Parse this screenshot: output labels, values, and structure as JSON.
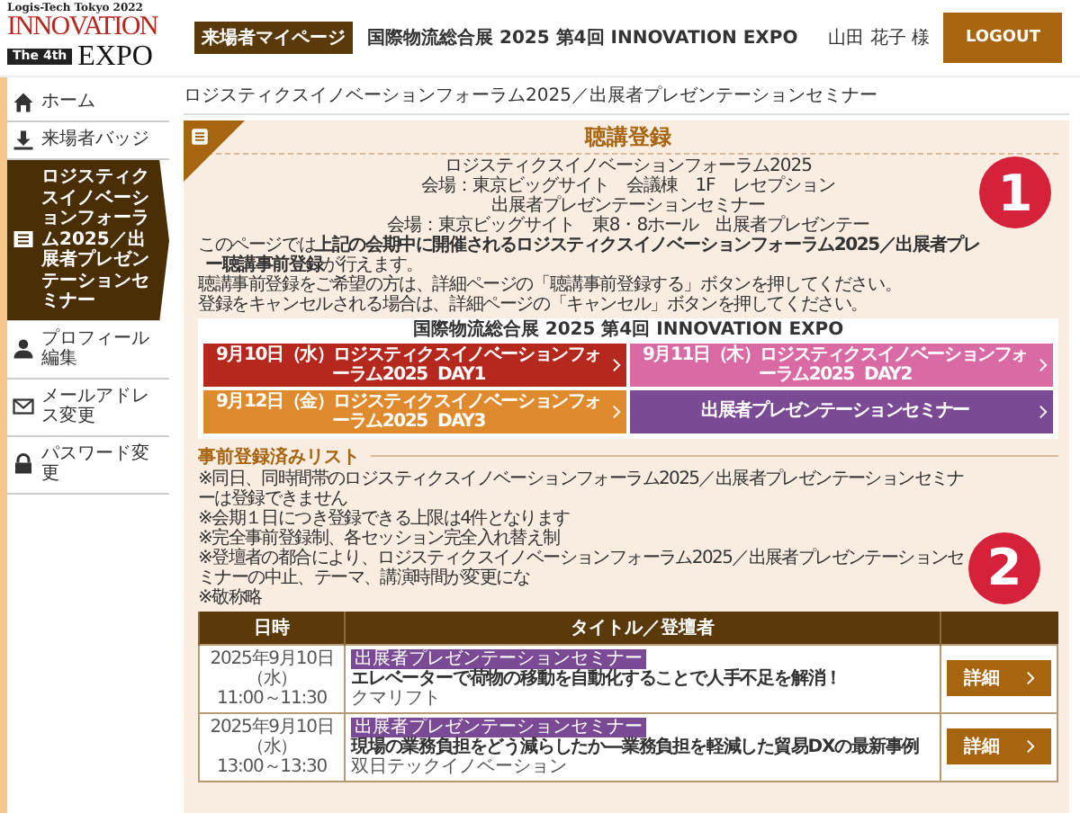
{
  "header": {
    "logo": {
      "tagline": "Logis-Tech Tokyo 2022",
      "word1": "INNOVATION",
      "edition": "The 4th",
      "word2": "EXPO"
    },
    "badge": "来場者マイページ",
    "event_title": "国際物流総合展 2025 第4回 INNOVATION EXPO",
    "user_name": "山田 花子 様",
    "logout": "LOGOUT"
  },
  "sidebar": {
    "items": [
      {
        "kind": "home",
        "label": "ホーム",
        "selected": false
      },
      {
        "kind": "download",
        "label": "来場者バッジ",
        "selected": false
      },
      {
        "kind": "list",
        "label": "ロジスティクスイノベーションフォーラム2025／出展者プレゼンテーションセミナー",
        "selected": true
      },
      {
        "kind": "person",
        "label": "プロフィール編集",
        "selected": false
      },
      {
        "kind": "mail",
        "label": "メールアドレス変更",
        "selected": false
      },
      {
        "kind": "lock",
        "label": "パスワード変更",
        "selected": false
      }
    ]
  },
  "page_title": "ロジスティクスイノベーションフォーラム2025／出展者プレゼンテーションセミナー",
  "card": {
    "heading": "聴講登録",
    "info_lines": [
      "ロジスティクスイノベーションフォーラム2025",
      "会場：東京ビッグサイト　会議棟　1F　レセプション",
      "出展者プレゼンテーションセミナー",
      "会場：東京ビッグサイト　東8・8ホール　出展者プレゼンテー"
    ],
    "notice_lead": "このページでは**上記の会期中に開催されるロジスティクスイノベーションフォーラム2025／出展者プレ**",
    "notice_tail": "**ー聴講事前登録**が行えます。",
    "notice": [
      "聴講事前登録をご希望の方は、詳細ページの「聴講事前登録する」ボタンを押してください。",
      "登録をキャンセルされる場合は、詳細ページの「キャンセル」ボタンを押してください。"
    ],
    "event_box": {
      "title": "国際物流総合展 2025 第4回 INNOVATION EXPO",
      "buttons": [
        {
          "label": "9月10日（水）ロジスティクスイノベーションフォーラム2025",
          "day": "DAY1",
          "color": "#b5281e"
        },
        {
          "label": "9月11日（木）ロジスティクスイノベーションフォーラム2025",
          "day": "DAY2",
          "color": "#d96aa4"
        },
        {
          "label": "9月12日（金）ロジスティクスイノベーションフォーラム2025",
          "day": "DAY3",
          "color": "#e08a2e"
        },
        {
          "label": "出展者プレゼンテーションセミナー",
          "color": "#7b4a94"
        }
      ]
    }
  },
  "list": {
    "heading": "事前登録済みリスト",
    "notes": [
      "※同日、同時間帯のロジスティクスイノベーションフォーラム2025／出展者プレゼンテーションセミナーは登録できません",
      "※会期１日につき登録できる上限は4件となります",
      "※完全事前登録制、各セッション完全入れ替え制",
      "※登壇者の都合により、ロジスティクスイノベーションフォーラム2025／出展者プレゼンテーションセミナーの中止、テーマ、講演時間が変更にな",
      "※敬称略"
    ],
    "table": {
      "columns": [
        "日時",
        "タイトル／登壇者"
      ],
      "rows": [
        {
          "date": "2025年9月10日（水）",
          "time": "11:00～11:30",
          "tag": "出展者プレゼンテーションセミナー",
          "title": "エレベーターで荷物の移動を自動化することで人手不足を解消！",
          "speaker": "クマリフト",
          "action": "詳細"
        },
        {
          "date": "2025年9月10日（水）",
          "time": "13:00～13:30",
          "tag": "出展者プレゼンテーションセミナー",
          "title": "現場の業務負担をどう減らしたか―業務負担を軽減した貿易DXの最新事例",
          "speaker": "双日テックイノベーション",
          "action": "詳細"
        }
      ]
    }
  },
  "annotations": [
    "1",
    "2"
  ]
}
